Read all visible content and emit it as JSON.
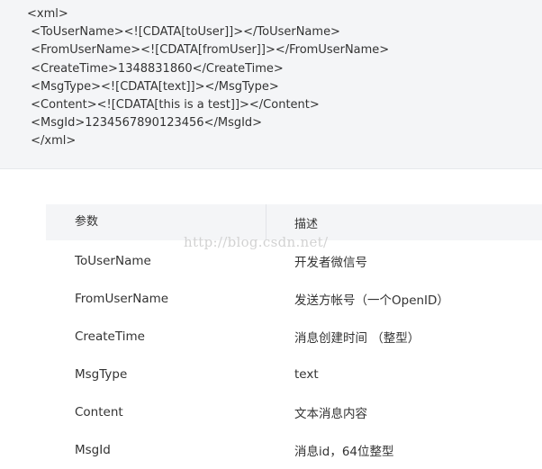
{
  "code_block": {
    "lines": [
      "<xml>",
      " <ToUserName><![CDATA[toUser]]></ToUserName>",
      " <FromUserName><![CDATA[fromUser]]></FromUserName>",
      " <CreateTime>1348831860</CreateTime>",
      " <MsgType><![CDATA[text]]></MsgType>",
      " <Content><![CDATA[this is a test]]></Content>",
      " <MsgId>1234567890123456</MsgId>",
      " </xml>"
    ]
  },
  "table": {
    "headers": {
      "param": "参数",
      "desc": "描述"
    },
    "rows": [
      {
        "param": "ToUserName",
        "desc": "开发者微信号"
      },
      {
        "param": "FromUserName",
        "desc": "发送方帐号（一个OpenID）"
      },
      {
        "param": "CreateTime",
        "desc": "消息创建时间 （整型）"
      },
      {
        "param": "MsgType",
        "desc": "text"
      },
      {
        "param": "Content",
        "desc": "文本消息内容"
      },
      {
        "param": "MsgId",
        "desc": "消息id，64位整型"
      }
    ]
  },
  "watermark": "http://blog.csdn.net/"
}
